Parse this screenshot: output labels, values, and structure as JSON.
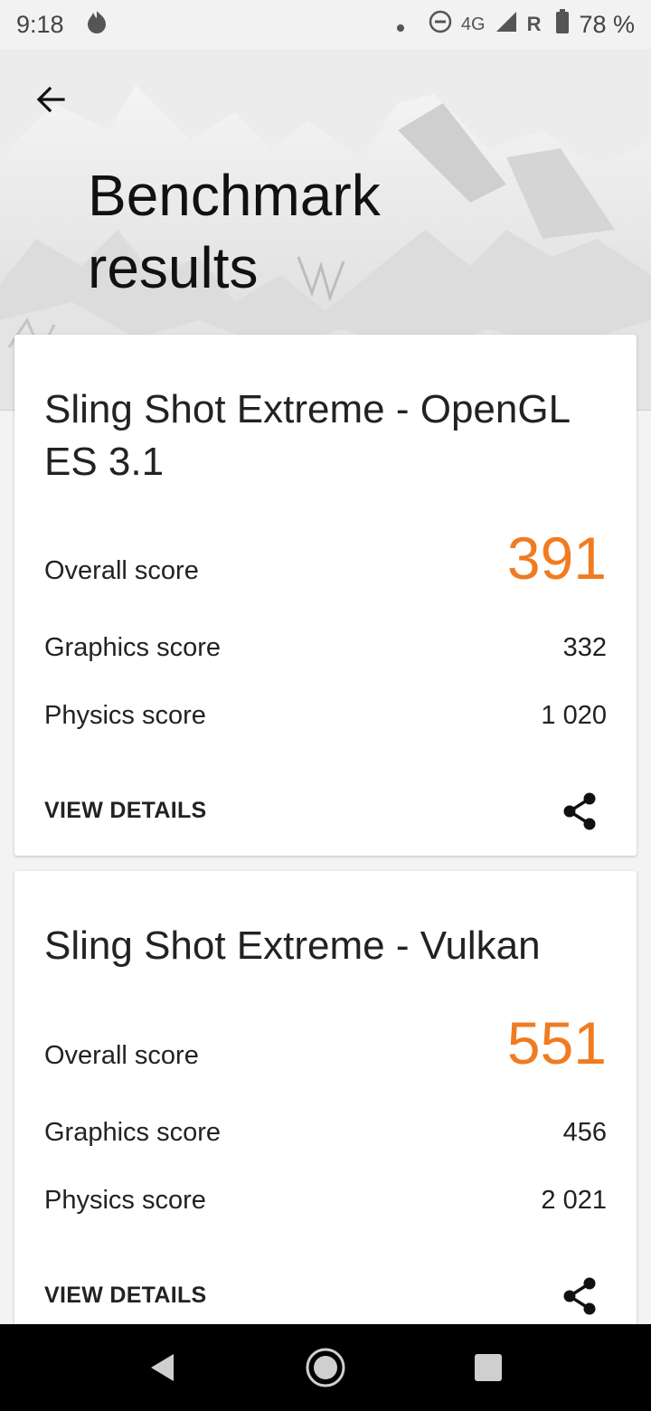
{
  "status_bar": {
    "time": "9:18",
    "network": "4G",
    "roaming": "R",
    "battery": "78 %"
  },
  "header": {
    "title": "Benchmark results"
  },
  "results": [
    {
      "title": "Sling Shot Extreme - OpenGL ES 3.1",
      "overall_label": "Overall score",
      "overall_value": "391",
      "graphics_label": "Graphics score",
      "graphics_value": "332",
      "physics_label": "Physics score",
      "physics_value": "1 020",
      "details_label": "VIEW DETAILS"
    },
    {
      "title": "Sling Shot Extreme - Vulkan",
      "overall_label": "Overall score",
      "overall_value": "551",
      "graphics_label": "Graphics score",
      "graphics_value": "456",
      "physics_label": "Physics score",
      "physics_value": "2 021",
      "details_label": "VIEW DETAILS"
    }
  ],
  "colors": {
    "accent_score": "#f07b21"
  },
  "icons": {
    "back": "arrow-left-icon",
    "share": "share-icon",
    "nav_back": "triangle-back-icon",
    "nav_home": "circle-home-icon",
    "nav_recents": "square-recents-icon"
  }
}
